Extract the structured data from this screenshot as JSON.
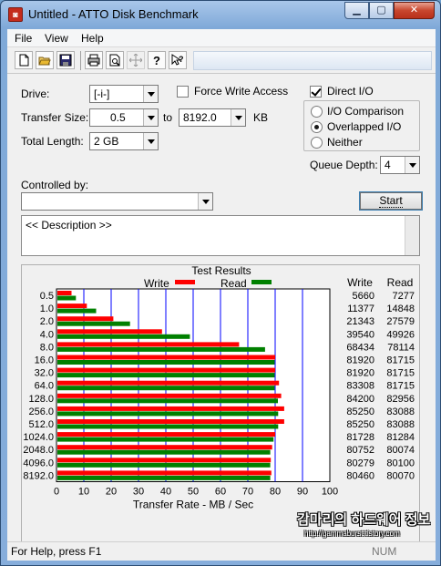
{
  "window": {
    "title": "Untitled - ATTO Disk Benchmark",
    "app_icon": "atto-icon"
  },
  "menu": [
    "File",
    "View",
    "Help"
  ],
  "toolbar": {
    "icons": [
      "new-icon",
      "open-icon",
      "save-icon",
      "print-icon",
      "print-preview-icon",
      "move-icon",
      "help-icon",
      "context-help-icon"
    ]
  },
  "settings": {
    "drive_label": "Drive:",
    "drive_value": "[-i-]",
    "force_write_label": "Force Write Access",
    "force_write_checked": false,
    "direct_io_label": "Direct I/O",
    "direct_io_checked": true,
    "transfer_size_label": "Transfer Size:",
    "transfer_from": "0.5",
    "to_label": "to",
    "transfer_to": "8192.0",
    "transfer_unit": "KB",
    "total_length_label": "Total Length:",
    "total_length": "2 GB",
    "io_modes": [
      {
        "label": "I/O Comparison",
        "checked": false
      },
      {
        "label": "Overlapped I/O",
        "checked": true
      },
      {
        "label": "Neither",
        "checked": false
      }
    ],
    "queue_depth_label": "Queue Depth:",
    "queue_depth": "4",
    "controlled_by_label": "Controlled by:",
    "controlled_by": "",
    "start_label": "Start",
    "description": "<< Description >>"
  },
  "chart_data": {
    "type": "bar",
    "title": "Test Results",
    "xlabel": "Transfer Rate - MB / Sec",
    "xlim": [
      0,
      100
    ],
    "xticks": [
      "0",
      "10",
      "20",
      "30",
      "40",
      "50",
      "60",
      "70",
      "80",
      "90",
      "100"
    ],
    "categories": [
      "0.5",
      "1.0",
      "2.0",
      "4.0",
      "8.0",
      "16.0",
      "32.0",
      "64.0",
      "128.0",
      "256.0",
      "512.0",
      "1024.0",
      "2048.0",
      "4096.0",
      "8192.0"
    ],
    "series": [
      {
        "name": "Write",
        "color": "#ff0000",
        "values": [
          5.5,
          11.1,
          20.8,
          38.6,
          66.8,
          80.0,
          80.0,
          81.4,
          82.2,
          83.3,
          83.3,
          80.0,
          78.9,
          78.4,
          78.6
        ]
      },
      {
        "name": "Read",
        "color": "#008000",
        "values": [
          7.1,
          14.5,
          26.9,
          48.8,
          76.3,
          79.8,
          79.8,
          79.8,
          81.0,
          81.1,
          81.1,
          79.4,
          78.2,
          78.2,
          78.2
        ]
      }
    ],
    "table_headers": [
      "Write",
      "Read"
    ],
    "table": [
      [
        "5660",
        "7277"
      ],
      [
        "11377",
        "14848"
      ],
      [
        "21343",
        "27579"
      ],
      [
        "39540",
        "49926"
      ],
      [
        "68434",
        "78114"
      ],
      [
        "81920",
        "81715"
      ],
      [
        "81920",
        "81715"
      ],
      [
        "83308",
        "81715"
      ],
      [
        "84200",
        "82956"
      ],
      [
        "85250",
        "83088"
      ],
      [
        "85250",
        "83088"
      ],
      [
        "81728",
        "81284"
      ],
      [
        "80752",
        "80074"
      ],
      [
        "80279",
        "80100"
      ],
      [
        "80460",
        "80070"
      ]
    ]
  },
  "status": {
    "help_text": "For Help, press F1",
    "indicator": "NUM"
  },
  "watermark": {
    "title": "감마리의 하드웨어 정보",
    "url": "http://gammaburst.tistory.com"
  }
}
